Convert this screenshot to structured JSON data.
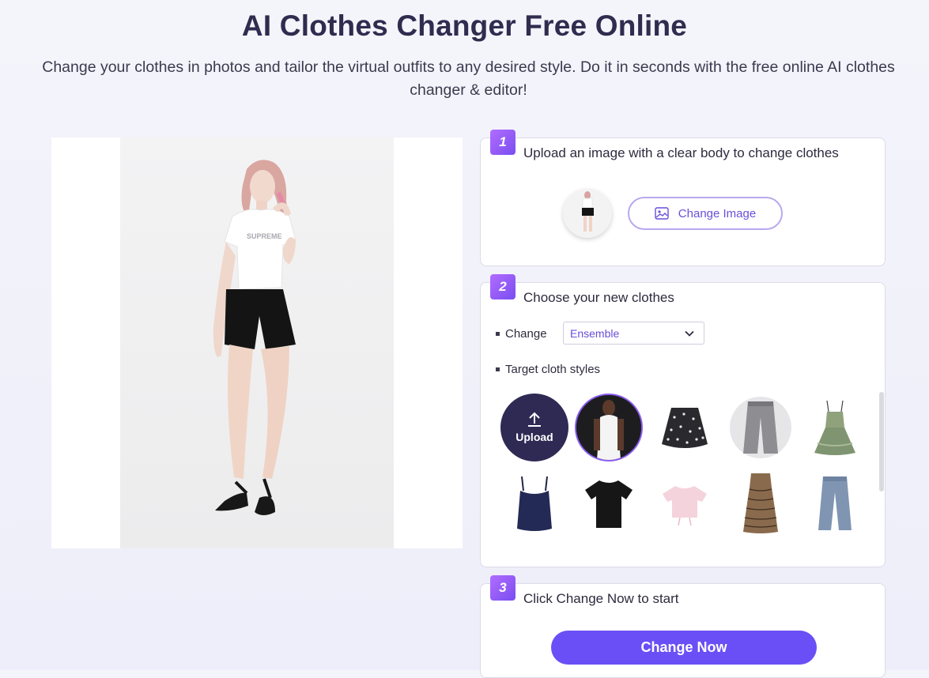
{
  "header": {
    "title": "AI Clothes Changer Free Online",
    "subtitle": "Change your clothes in photos and tailor the virtual outfits to any desired style. Do it in seconds with the free online AI clothes changer & editor!"
  },
  "colors": {
    "accent": "#6a4ff6",
    "badge": "#9a5cf6",
    "upload_bg": "#2f2a54"
  },
  "step1": {
    "number": "1",
    "title": "Upload an image with a clear body to change clothes",
    "change_image_label": "Change Image"
  },
  "step2": {
    "number": "2",
    "title": "Choose your new clothes",
    "change_label": "Change",
    "change_value": "Ensemble",
    "target_label": "Target cloth styles",
    "upload_label": "Upload",
    "styles": [
      "white-halter-top-model",
      "floral-skirt",
      "gray-wide-jeans",
      "green-ruffle-dress",
      "navy-cami-top",
      "black-tshirt",
      "pink-crop-top",
      "brown-print-dress",
      "blue-wide-jeans"
    ]
  },
  "step3": {
    "number": "3",
    "title": "Click Change Now to start",
    "button_label": "Change Now"
  }
}
